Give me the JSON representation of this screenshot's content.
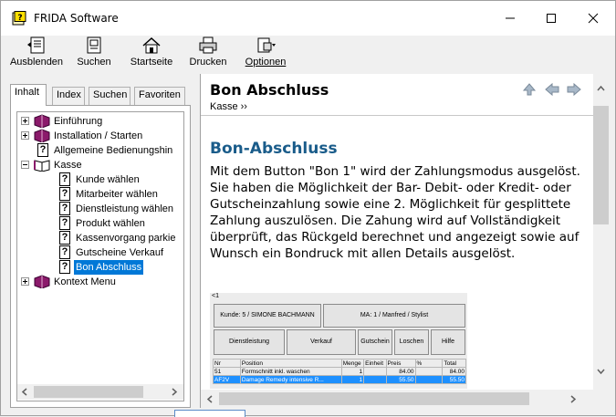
{
  "window": {
    "title": "FRIDA Software"
  },
  "toolbar": [
    {
      "label": "Ausblenden"
    },
    {
      "label": "Suchen"
    },
    {
      "label": "Startseite"
    },
    {
      "label": "Drucken"
    },
    {
      "label": "Optionen"
    }
  ],
  "nav_tabs": [
    {
      "label": "Inhalt",
      "active": true
    },
    {
      "label": "Index"
    },
    {
      "label": "Suchen"
    },
    {
      "label": "Favoriten"
    }
  ],
  "tree": [
    {
      "label": "Einführung",
      "type": "book",
      "expander": "plus"
    },
    {
      "label": "Installation / Starten",
      "type": "book",
      "expander": "plus"
    },
    {
      "label": "Allgemeine Bedienungshin",
      "type": "page"
    },
    {
      "label": "Kasse",
      "type": "open-book",
      "expander": "minus"
    },
    {
      "label": "Kunde wählen",
      "type": "page"
    },
    {
      "label": "Mitarbeiter wählen",
      "type": "page"
    },
    {
      "label": "Dienstleistung wählen",
      "type": "page"
    },
    {
      "label": "Produkt wählen",
      "type": "page"
    },
    {
      "label": "Kassenvorgang parkie",
      "type": "page"
    },
    {
      "label": "Gutscheine Verkauf",
      "type": "page"
    },
    {
      "label": "Bon Abschluss",
      "type": "page",
      "selected": true
    },
    {
      "label": "Kontext Menu",
      "type": "book",
      "expander": "plus"
    }
  ],
  "content": {
    "title": "Bon Abschluss",
    "breadcrumb": "Kasse ››",
    "heading": "Bon-Abschluss",
    "paragraph": "Mit dem Button \"Bon 1\" wird der Zahlungsmodus ausgelöst. Sie haben die Möglichkeit der Bar- Debit- oder Kredit- oder Gutscheinzahlung sowie eine 2. Möglichkeit für gesplittete Zahlung auszulösen. Die Zahung wird auf Vollständigkeit überprüft, das Rückgeld berechnet und angezeigt sowie auf Wunsch ein Bondruck mit allen Details ausgelöst."
  },
  "screenshot": {
    "marker": "<1",
    "customer_button": "Kunde: 5 / SIMONE BACHMANN",
    "staff_button": "MA: 1 / Manfred / Stylist",
    "buttons": [
      "Dienstleistung",
      "Verkauf",
      "Gutschein",
      "Loschen",
      "Hilfe"
    ],
    "table_headers": [
      "Nr",
      "Position",
      "Menge",
      "Einheit",
      "Preis",
      "%",
      "Total"
    ],
    "rows": [
      [
        "51",
        "Formschnitt inkl. waschen",
        "1",
        "",
        "84.00",
        "",
        "84.00"
      ],
      [
        "AF2V",
        "Damage Remedy intensive R...",
        "1",
        "",
        "55.50",
        "",
        "55.50"
      ]
    ]
  },
  "colors": {
    "heading": "#1a5c8a",
    "selection": "#0078d7"
  }
}
